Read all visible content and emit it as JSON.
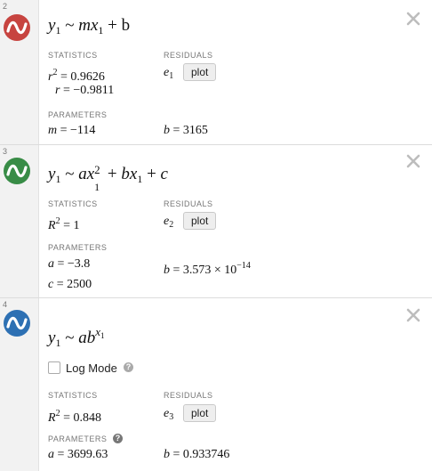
{
  "expressions": [
    {
      "number": "2",
      "icon": "regression-icon",
      "icon_color": "#c74440",
      "formula": {
        "y": "y",
        "y_sub": "1",
        "tilde": "~",
        "rhs_html": "mx",
        "x_sub": "1",
        "tail": "+ b"
      },
      "statistics_label": "STATISTICS",
      "residuals_label": "RESIDUALS",
      "stat_r2": {
        "sym": "r",
        "sup": "2",
        "value": "= 0.9626"
      },
      "stat_r": {
        "sym": "r",
        "value": "= −0.9811"
      },
      "residual": {
        "sym": "e",
        "sub": "1"
      },
      "plot_label": "plot",
      "parameters_label": "PARAMETERS",
      "param_1": {
        "sym": "m",
        "value": "= −114"
      },
      "param_2": {
        "sym": "b",
        "value": "= 3165"
      }
    },
    {
      "number": "3",
      "icon": "regression-icon",
      "icon_color": "#388c46",
      "statistics_label": "STATISTICS",
      "residuals_label": "RESIDUALS",
      "stat_R2": {
        "sym": "R",
        "sup": "2",
        "value": "= 1"
      },
      "residual": {
        "sym": "e",
        "sub": "2"
      },
      "plot_label": "plot",
      "parameters_label": "PARAMETERS",
      "param_a": {
        "sym": "a",
        "value": "= −3.8"
      },
      "param_b": {
        "sym": "b",
        "value": "= 3.573 × 10",
        "exp": "−14"
      },
      "param_c": {
        "sym": "c",
        "value": "= 2500"
      }
    },
    {
      "number": "4",
      "icon": "regression-icon",
      "icon_color": "#2d70b3",
      "log_mode_label": "Log Mode",
      "log_mode_checked": false,
      "statistics_label": "STATISTICS",
      "residuals_label": "RESIDUALS",
      "stat_R2": {
        "sym": "R",
        "sup": "2",
        "value": "= 0.848"
      },
      "residual": {
        "sym": "e",
        "sub": "3"
      },
      "plot_label": "plot",
      "parameters_label": "PARAMETERS",
      "param_a": {
        "sym": "a",
        "value": "= 3699.63"
      },
      "param_b": {
        "sym": "b",
        "value": "= 0.933746"
      }
    }
  ]
}
